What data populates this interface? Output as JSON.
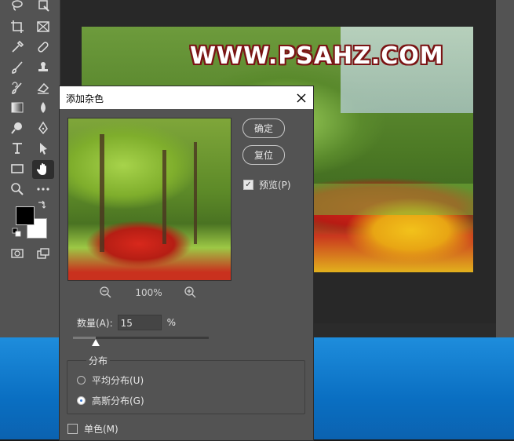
{
  "canvas": {
    "watermark": "WWW.PSAHZ.COM"
  },
  "toolbar": {
    "tools": [
      "lasso-icon",
      "magic-wand-icon",
      "crop-icon",
      "frame-icon",
      "eyedropper-icon",
      "healing-brush-icon",
      "brush-icon",
      "stamp-icon",
      "history-brush-icon",
      "eraser-icon",
      "gradient-icon",
      "blur-icon",
      "dodge-icon",
      "pen-icon",
      "type-icon",
      "path-select-icon",
      "rectangle-icon",
      "hand-icon",
      "zoom-icon",
      "more-tools-icon"
    ],
    "foreground_color": "#000000",
    "background_color": "#ffffff"
  },
  "dialog": {
    "title": "添加杂色",
    "ok_label": "确定",
    "reset_label": "复位",
    "preview_label": "预览(P)",
    "preview_checked": true,
    "zoom_level": "100%",
    "amount_label": "数量(A):",
    "amount_value": "15",
    "amount_unit": "%",
    "amount_slider_fraction": 0.17,
    "distribution": {
      "legend": "分布",
      "options": [
        {
          "label": "平均分布(U)",
          "selected": false
        },
        {
          "label": "高斯分布(G)",
          "selected": true
        }
      ]
    },
    "monochromatic_label": "单色(M)",
    "monochromatic_checked": false
  }
}
